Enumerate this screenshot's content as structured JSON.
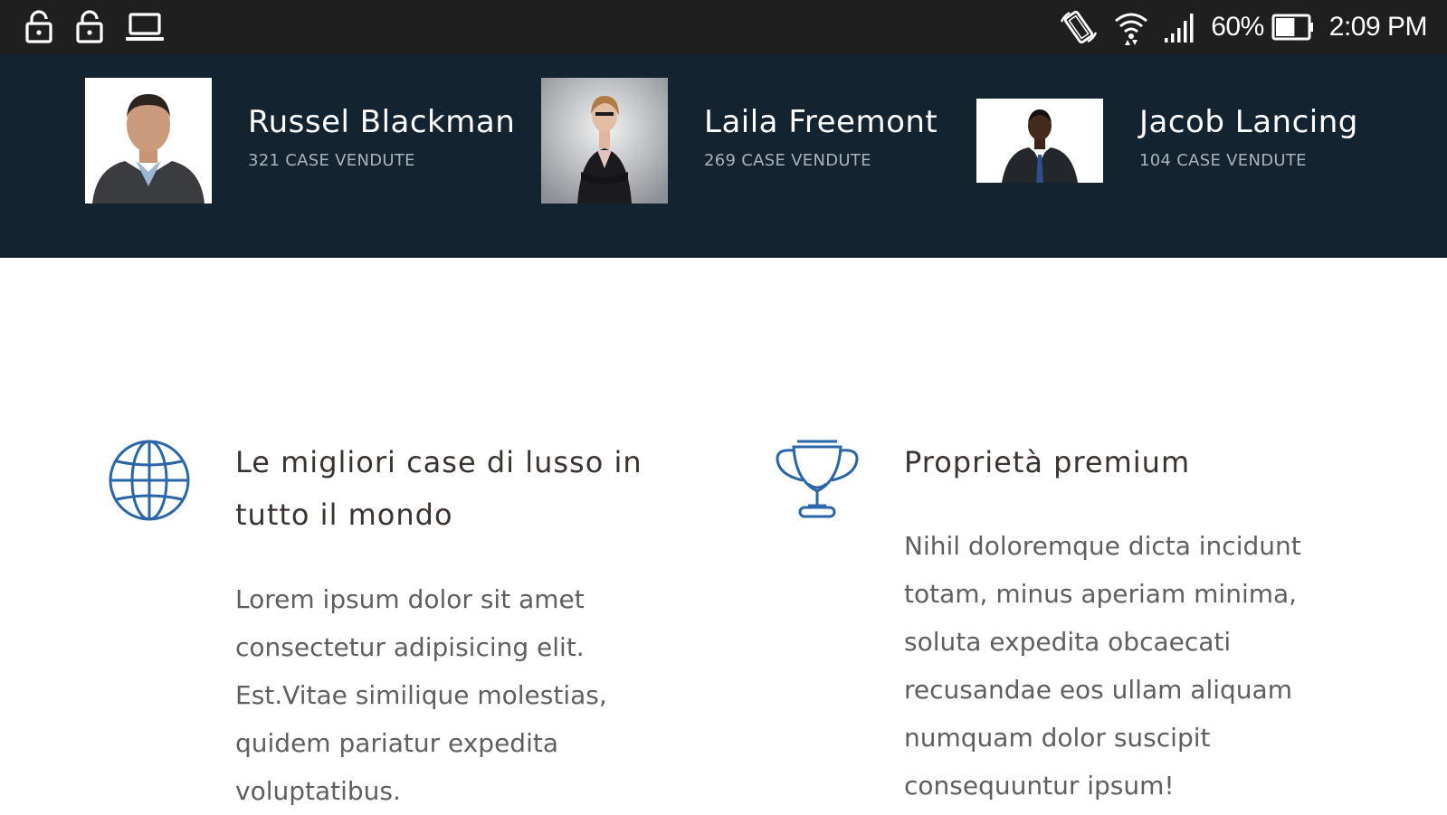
{
  "status_bar": {
    "left_icons": [
      "lock-icon",
      "lock-icon",
      "laptop-icon"
    ],
    "right_icons": [
      "auto-rotate-icon",
      "wifi-icon",
      "signal-icon"
    ],
    "battery_percent": "60%",
    "battery_level": 0.6,
    "time": "2:09 PM"
  },
  "agents": [
    {
      "name": "Russel Blackman",
      "sales": "321 CASE VENDUTE"
    },
    {
      "name": "Laila Freemont",
      "sales": "269 CASE VENDUTE"
    },
    {
      "name": "Jacob Lancing",
      "sales": "104 CASE VENDUTE"
    }
  ],
  "features": [
    {
      "icon": "globe-icon",
      "title": "Le migliori case di lusso in tutto il mondo",
      "text": "Lorem ipsum dolor sit amet consectetur adipisicing elit. Est.Vitae similique molestias, quidem pariatur expedita voluptatibus."
    },
    {
      "icon": "trophy-icon",
      "title": "Proprietà premium",
      "text": "Nihil doloremque dicta incidunt totam, minus aperiam minima, soluta expedita obcaecati recusandae eos ullam aliquam numquam dolor suscipit consequuntur ipsum!"
    }
  ],
  "colors": {
    "status_bar_bg": "#1f1f1f",
    "agents_band_bg": "#13232f",
    "accent_icon": "#2a66a8",
    "title_text": "#3a3330",
    "body_text": "#5f5f5f"
  }
}
